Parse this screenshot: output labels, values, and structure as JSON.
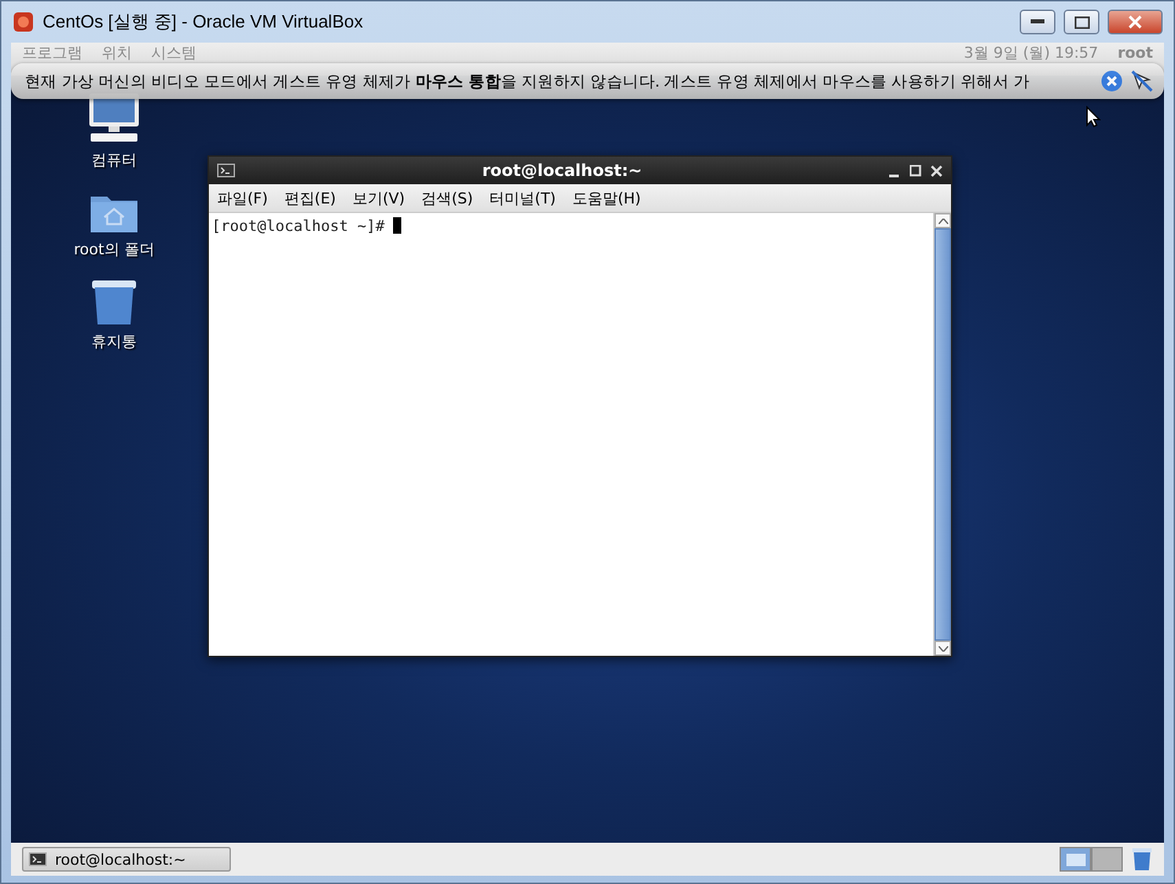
{
  "window": {
    "title": "CentOs [실행 중] - Oracle VM VirtualBox"
  },
  "guest_panel": {
    "menus": [
      "프로그램",
      "위치",
      "시스템"
    ],
    "clock": "3월 9일 (월) 19:57",
    "user": "root"
  },
  "notice": {
    "text": "현재 가상 머신의 비디오 모드에서 게스트 유영 체제가 **마우스 통합**을 지원하지 않습니다. 게스트 유영 체제에서 마우스를 사용하기 위해서 가"
  },
  "desktop_icons": [
    {
      "kind": "computer",
      "label": "컴퓨터"
    },
    {
      "kind": "folder",
      "label": "root의 폴더"
    },
    {
      "kind": "trash",
      "label": "휴지통"
    }
  ],
  "terminal": {
    "title": "root@localhost:~",
    "menus": [
      "파일(F)",
      "편집(E)",
      "보기(V)",
      "검색(S)",
      "터미널(T)",
      "도움말(H)"
    ],
    "prompt": "[root@localhost ~]#"
  },
  "taskbar": {
    "items": [
      {
        "label": "root@localhost:~",
        "selected": false
      }
    ],
    "workspaces": [
      {
        "selected": true
      },
      {
        "selected": false
      }
    ]
  }
}
